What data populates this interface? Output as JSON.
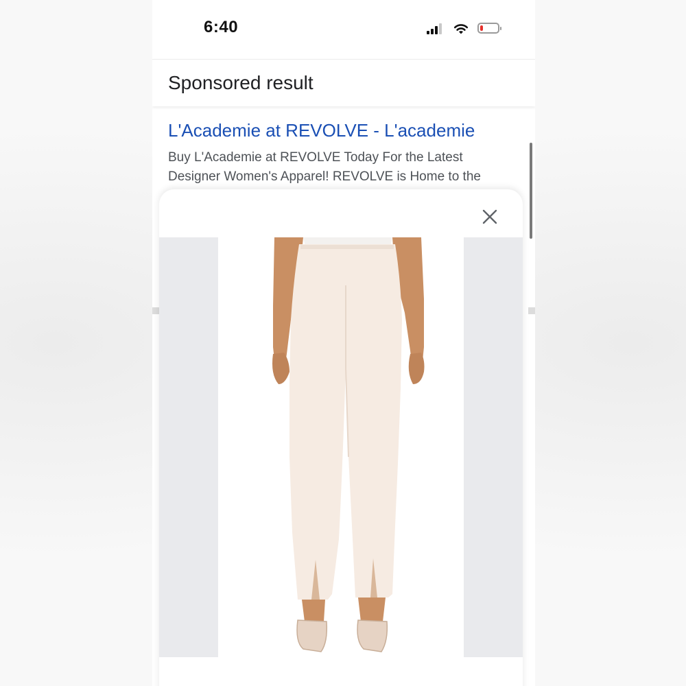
{
  "status_bar": {
    "time": "6:40",
    "signal_icon": "cellular-signal-icon",
    "wifi_icon": "wifi-icon",
    "battery_icon": "battery-low-icon",
    "battery_level": 0.18,
    "battery_color": "#e5312b"
  },
  "page": {
    "header": "Sponsored result",
    "result": {
      "title": "L'Academie at REVOLVE - L'academie",
      "description": "Buy L'Academie at REVOLVE Today For the Latest Designer Women's Apparel! REVOLVE is Home to the",
      "link_color": "#1a4fb4"
    }
  },
  "sheet": {
    "close_icon": "close-icon",
    "image": "product-photo-cream-trousers"
  }
}
